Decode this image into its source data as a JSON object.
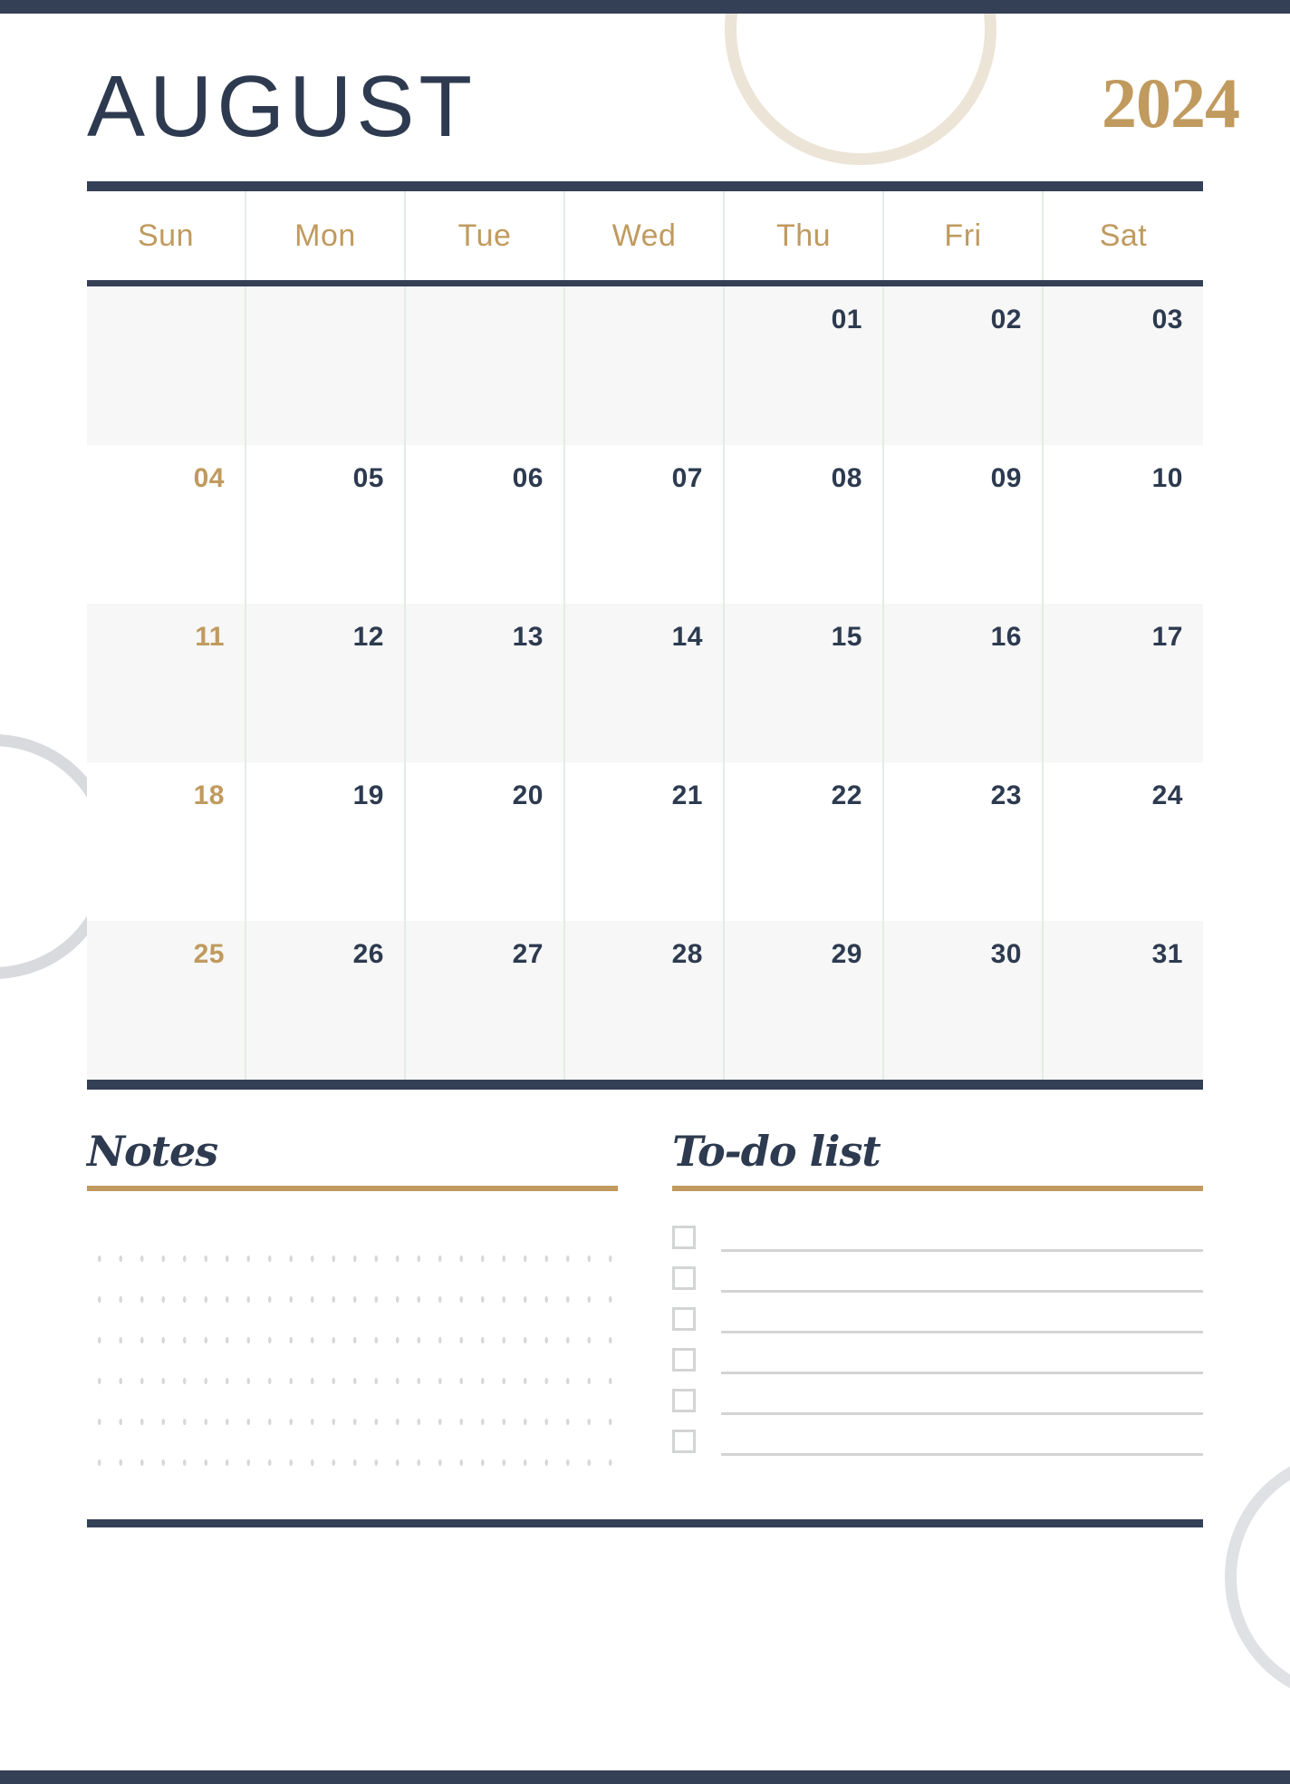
{
  "document": {
    "type": "monthly-calendar-planner",
    "month": "AUGUST",
    "year": "2024"
  },
  "colors": {
    "navy": "#344056",
    "gold": "#C09A5E",
    "cell_shade": "#F6F7F6",
    "grid_line": "#E4ECE6",
    "placeholder_gray": "#D3D5D4"
  },
  "calendar": {
    "weekdays": [
      "Sun",
      "Mon",
      "Tue",
      "Wed",
      "Thu",
      "Fri",
      "Sat"
    ],
    "weeks": [
      {
        "shaded": true,
        "days": [
          {
            "label": "",
            "empty": true,
            "sunday": true
          },
          {
            "label": "",
            "empty": true,
            "sunday": false
          },
          {
            "label": "",
            "empty": true,
            "sunday": false
          },
          {
            "label": "",
            "empty": true,
            "sunday": false
          },
          {
            "label": "01",
            "empty": false,
            "sunday": false
          },
          {
            "label": "02",
            "empty": false,
            "sunday": false
          },
          {
            "label": "03",
            "empty": false,
            "sunday": false
          }
        ]
      },
      {
        "shaded": false,
        "days": [
          {
            "label": "04",
            "empty": false,
            "sunday": true
          },
          {
            "label": "05",
            "empty": false,
            "sunday": false
          },
          {
            "label": "06",
            "empty": false,
            "sunday": false
          },
          {
            "label": "07",
            "empty": false,
            "sunday": false
          },
          {
            "label": "08",
            "empty": false,
            "sunday": false
          },
          {
            "label": "09",
            "empty": false,
            "sunday": false
          },
          {
            "label": "10",
            "empty": false,
            "sunday": false
          }
        ]
      },
      {
        "shaded": true,
        "days": [
          {
            "label": "11",
            "empty": false,
            "sunday": true
          },
          {
            "label": "12",
            "empty": false,
            "sunday": false
          },
          {
            "label": "13",
            "empty": false,
            "sunday": false
          },
          {
            "label": "14",
            "empty": false,
            "sunday": false
          },
          {
            "label": "15",
            "empty": false,
            "sunday": false
          },
          {
            "label": "16",
            "empty": false,
            "sunday": false
          },
          {
            "label": "17",
            "empty": false,
            "sunday": false
          }
        ]
      },
      {
        "shaded": false,
        "days": [
          {
            "label": "18",
            "empty": false,
            "sunday": true
          },
          {
            "label": "19",
            "empty": false,
            "sunday": false
          },
          {
            "label": "20",
            "empty": false,
            "sunday": false
          },
          {
            "label": "21",
            "empty": false,
            "sunday": false
          },
          {
            "label": "22",
            "empty": false,
            "sunday": false
          },
          {
            "label": "23",
            "empty": false,
            "sunday": false
          },
          {
            "label": "24",
            "empty": false,
            "sunday": false
          }
        ]
      },
      {
        "shaded": true,
        "days": [
          {
            "label": "25",
            "empty": false,
            "sunday": true
          },
          {
            "label": "26",
            "empty": false,
            "sunday": false
          },
          {
            "label": "27",
            "empty": false,
            "sunday": false
          },
          {
            "label": "28",
            "empty": false,
            "sunday": false
          },
          {
            "label": "29",
            "empty": false,
            "sunday": false
          },
          {
            "label": "30",
            "empty": false,
            "sunday": false
          },
          {
            "label": "31",
            "empty": false,
            "sunday": false
          }
        ]
      }
    ]
  },
  "notes": {
    "title": "Notes",
    "rows": 6
  },
  "todo": {
    "title": "To-do list",
    "items": [
      {
        "checked": false,
        "text": ""
      },
      {
        "checked": false,
        "text": ""
      },
      {
        "checked": false,
        "text": ""
      },
      {
        "checked": false,
        "text": ""
      },
      {
        "checked": false,
        "text": ""
      },
      {
        "checked": false,
        "text": ""
      }
    ]
  }
}
